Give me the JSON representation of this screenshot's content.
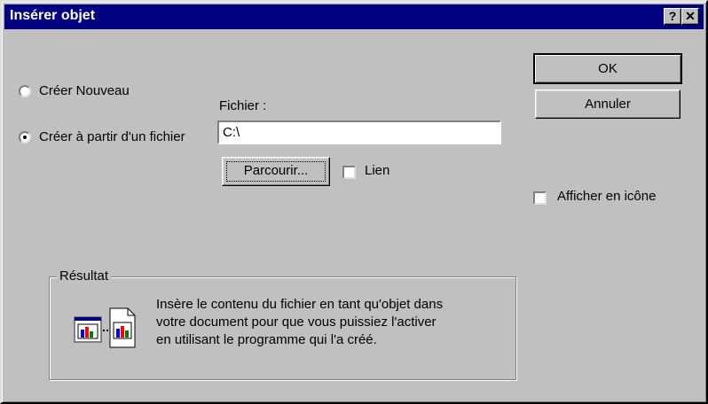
{
  "window": {
    "title": "Insérer objet",
    "help_button": "?",
    "close_button": "✕"
  },
  "options": {
    "create_new": "Créer Nouveau",
    "create_from_file": "Créer à partir d'un fichier"
  },
  "file": {
    "label": "Fichier :",
    "value": "C:\\"
  },
  "buttons": {
    "browse": "Parcourir...",
    "ok": "OK",
    "cancel": "Annuler"
  },
  "link": {
    "label": "Lien",
    "checked": false
  },
  "display_as_icon": {
    "label": "Afficher en icône",
    "checked": false
  },
  "result": {
    "title": "Résultat",
    "line1": "Insère le contenu du fichier en tant qu'objet dans",
    "line2": "votre document pour que vous puissiez l'activer",
    "line3": "en utilisant le programme qui l'a créé."
  }
}
